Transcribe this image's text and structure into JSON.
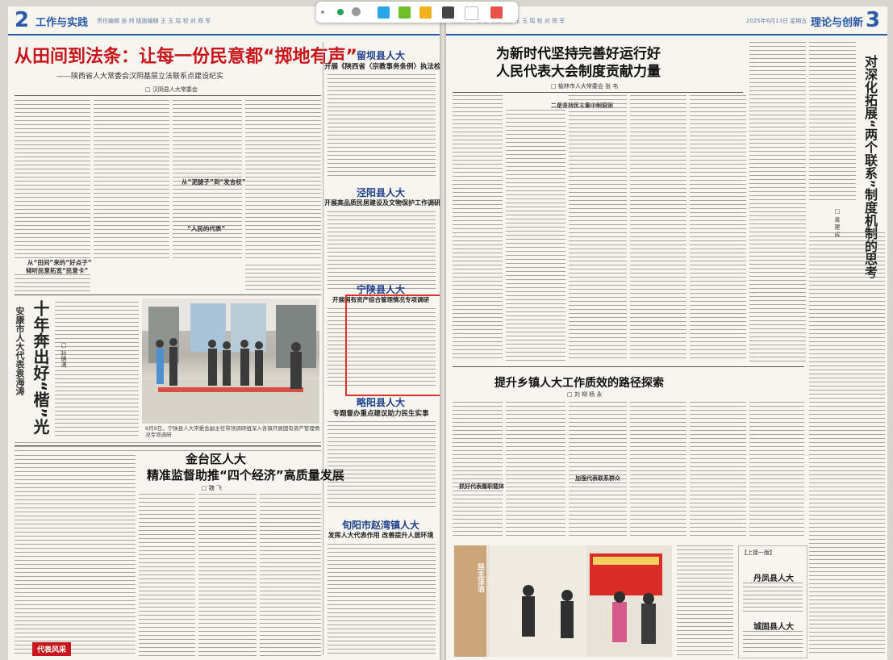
{
  "toolbar": {
    "swatches": [
      "#2aa3e8",
      "#6fbf2a",
      "#f2b01e",
      "#444444",
      "#ffffff",
      "#e8524a"
    ]
  },
  "left_page": {
    "page_number": "2",
    "section": "工作与实践",
    "meta": "责任编辑 张 帅  版面编辑 王 玉 瑶  校 对  郑 军",
    "lead": {
      "title": "从田间到法条：让每一份民意都“掷地有声”",
      "subtitle": "——陕西省人大常委会汉阴基层立法联系点建设纪实",
      "byline": "□ 汉阴县人大常委会",
      "subhead1": "从“田间”来的“好点子”",
      "subhead2": "倾听民意拓宽“民意卡”",
      "subhead3": "从“泥腿子”到“发言权”",
      "subhead4": "“人民的代表”"
    },
    "feature": {
      "vtitle1": "十年奔出好“楷”光",
      "vtitle2": "安康市人大代表袁海涛",
      "byline": "□ 孙明涛"
    },
    "photo_caption": "6月9日，宁陕县人大常委会副主任带领调研组深入各镇开展国有资产管理情况专项调研",
    "bottom": {
      "title1": "金台区人大",
      "title2": "精准监督助推“四个经济”高质量发展",
      "byline": "□ 魏 飞",
      "footer_tag": "代表风采"
    }
  },
  "middle_boxes": [
    {
      "title": "留坝县人大",
      "subtitle": "开展《陕西省〈宗教事务条例〉执法检查》"
    },
    {
      "title": "泾阳县人大",
      "subtitle": "开展高品质民居建设及文物保护工作调研"
    },
    {
      "title": "宁陕县人大",
      "subtitle": "开展国有资产综合管理情况专项调研"
    },
    {
      "title": "略阳县人大",
      "subtitle": "专题督办重点建议助力民生实事"
    },
    {
      "title": "旬阳市赵湾镇人大",
      "subtitle": "发挥人大代表作用 改善提升人居环境"
    }
  ],
  "right_page": {
    "page_number": "3",
    "section": "理论与创新",
    "meta": "2025年6月13日  星期五",
    "meta2": "责任编辑 杜 佳  版面编辑 王 玉 瑶  校 对  郑 军",
    "lead": {
      "title_line1": "为新时代坚持完善好运行好",
      "title_line2": "人民代表大会制度贡献力量",
      "byline": "□ 榆林市人大常委会 张 韦",
      "subhead": "二是坚持民主集中制原则"
    },
    "vertical": {
      "title": "对深化拓展“两个联系”制度机制的思考",
      "byline": "□ 袁 建 成"
    },
    "second": {
      "title": "提升乡镇人大工作质效的路径探索",
      "byline": "□ 刘 柳 杨 永",
      "subhead1": "抓好代表履职载体",
      "subhead2": "加强代表联系群众"
    },
    "sidebar": {
      "label": "【上接一版】",
      "item1": "丹凤县人大",
      "item2": "城固县人大"
    },
    "photo_label": "民主法治"
  }
}
